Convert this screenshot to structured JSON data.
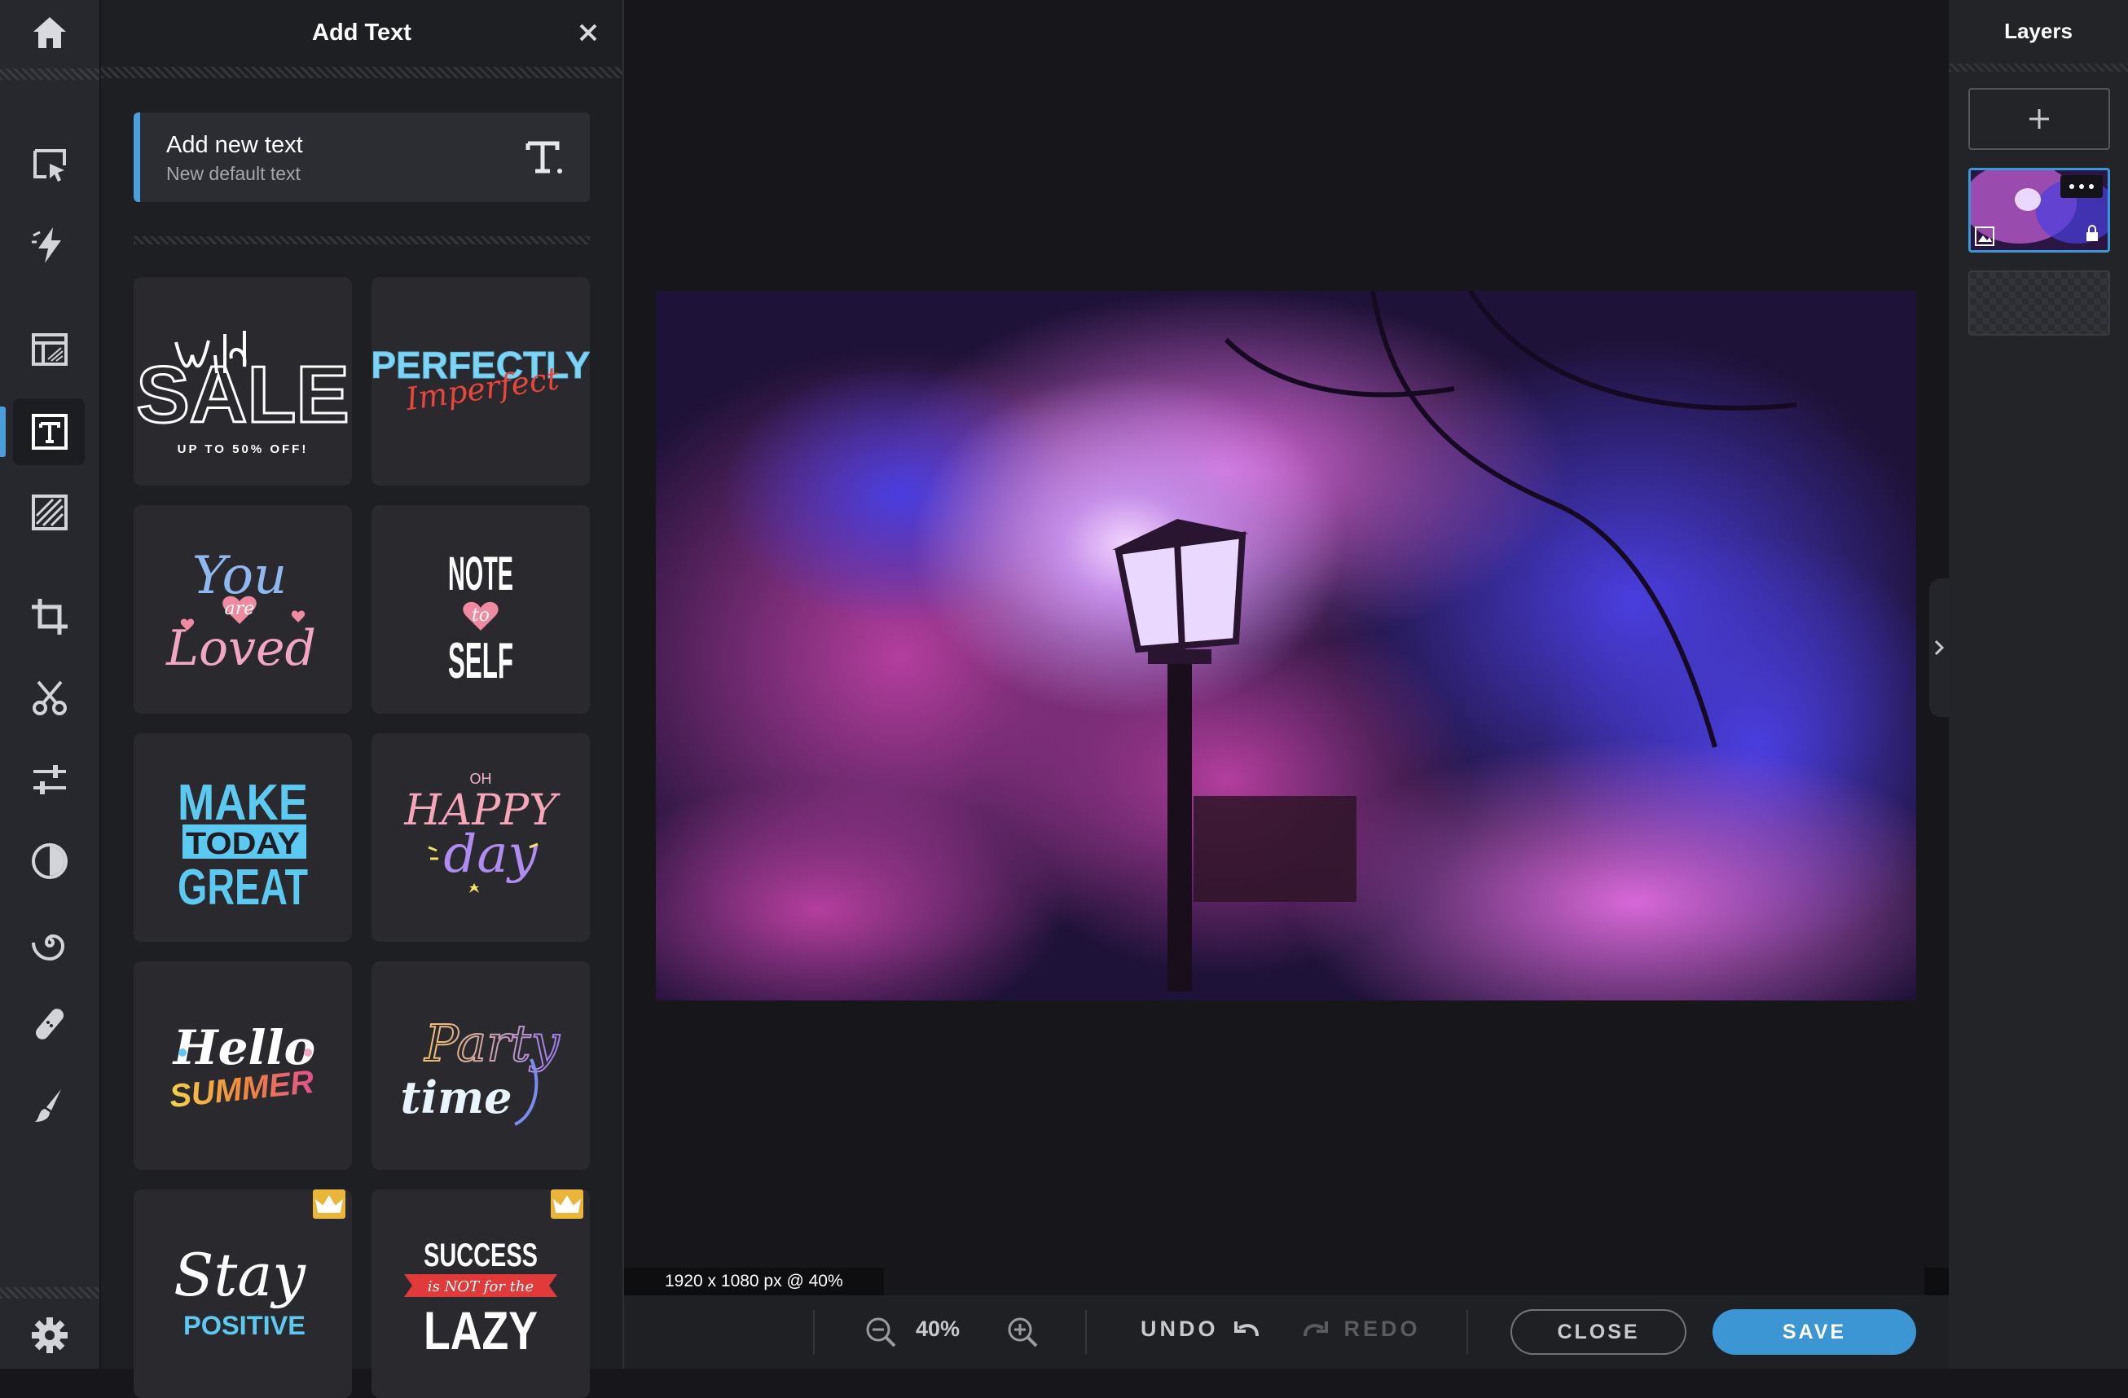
{
  "rail": {
    "items": [
      "home-icon",
      "select-icon",
      "quick-edit-icon",
      "templates-icon",
      "text-icon",
      "texture-icon",
      "crop-icon",
      "cutout-icon",
      "adjust-icon",
      "filter-icon",
      "effects-icon",
      "retouch-icon",
      "draw-icon",
      "settings-icon"
    ],
    "active": "text-icon"
  },
  "panel": {
    "title": "Add Text",
    "add_new": {
      "title": "Add new text",
      "subtitle": "New default text"
    },
    "templates": [
      {
        "text": "Wild SALE UP TO 50% OFF!",
        "premium": false
      },
      {
        "text": "PERFECTLY Imperfect",
        "premium": false
      },
      {
        "text": "You are Loved",
        "premium": false
      },
      {
        "text": "NOTE to SELF",
        "premium": false
      },
      {
        "text": "MAKE TODAY GREAT",
        "premium": false
      },
      {
        "text": "OH HAPPY day",
        "premium": false
      },
      {
        "text": "Hello SUMMER",
        "premium": false
      },
      {
        "text": "Party time",
        "premium": false
      },
      {
        "text": "Stay POSITIVE",
        "premium": true
      },
      {
        "text": "SUCCESS is NOT for the LAZY",
        "premium": true
      }
    ]
  },
  "canvas": {
    "info": "1920 x 1080 px @ 40%"
  },
  "toolbar": {
    "zoom": "40%",
    "undo": "UNDO",
    "redo": "REDO",
    "close": "CLOSE",
    "save": "SAVE"
  },
  "layers": {
    "title": "Layers",
    "add": "+"
  },
  "colors": {
    "accent": "#3d96d4",
    "panel": "#1e1f23",
    "rail": "#27282d",
    "premium": "#e9b53b"
  }
}
